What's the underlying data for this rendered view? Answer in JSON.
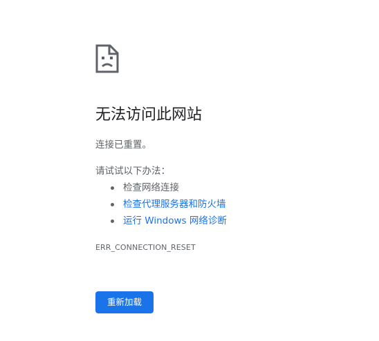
{
  "icon": "sad-page-icon",
  "title": "无法访问此网站",
  "subtitle": "连接已重置。",
  "suggestions": {
    "heading": "请试试以下办法：",
    "items": [
      {
        "label": "检查网络连接",
        "link": false
      },
      {
        "label": "检查代理服务器和防火墙",
        "link": true
      },
      {
        "label": "运行 Windows 网络诊断",
        "link": true
      }
    ]
  },
  "error_code": "ERR_CONNECTION_RESET",
  "reload_button": "重新加载",
  "colors": {
    "text": "#5f6368",
    "title": "#202124",
    "link": "#1a73e8",
    "button": "#1a73e8"
  }
}
